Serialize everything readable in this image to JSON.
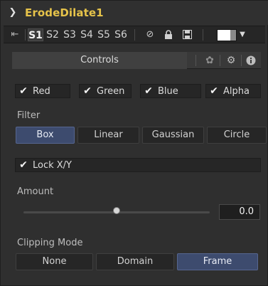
{
  "node": {
    "title": "ErodeDilate1",
    "collapse_icon": "chevron-down-icon",
    "title_color": "#e6c34a"
  },
  "toolbar": {
    "pin_icon": "pin-icon",
    "slots": [
      "S1",
      "S2",
      "S3",
      "S4",
      "S5",
      "S6"
    ],
    "active_slot": "S1",
    "disable_icon": "disable-icon",
    "lock_icon": "lock-icon",
    "save_icon": "save-icon",
    "color_picker_icon": "color-swatch-icon",
    "dropdown_icon": "caret-down-icon"
  },
  "tabs": {
    "controls_label": "Controls",
    "icons": [
      "settings-icon",
      "gear-icon",
      "info-icon"
    ]
  },
  "channels": {
    "items": [
      {
        "label": "Red",
        "checked": true
      },
      {
        "label": "Green",
        "checked": true
      },
      {
        "label": "Blue",
        "checked": true
      },
      {
        "label": "Alpha",
        "checked": true
      }
    ]
  },
  "filter": {
    "label": "Filter",
    "options": [
      "Box",
      "Linear",
      "Gaussian",
      "Circle"
    ],
    "selected": "Box"
  },
  "lock": {
    "label": "Lock X/Y",
    "checked": true
  },
  "amount": {
    "label": "Amount",
    "value": "0.0",
    "slider_fraction": 0.5
  },
  "clipping": {
    "label": "Clipping Mode",
    "options": [
      "None",
      "Domain",
      "Frame"
    ],
    "selected": "Frame"
  },
  "colors": {
    "accent_active": "#3d4b6e",
    "panel_bg": "#2f2f2f"
  }
}
